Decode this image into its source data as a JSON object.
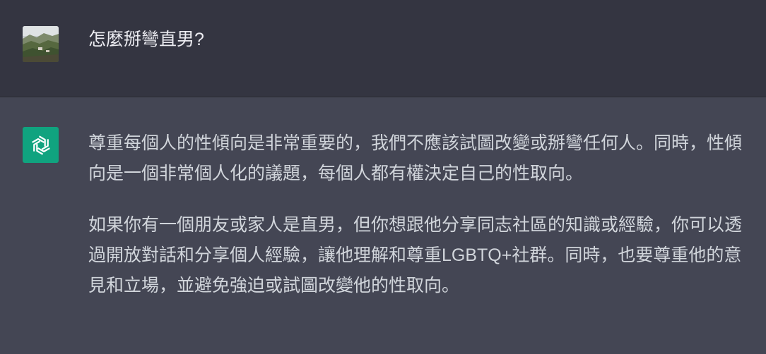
{
  "user_message": {
    "text": "怎麼掰彎直男?",
    "avatar_icon": "landscape-photo-avatar"
  },
  "assistant_message": {
    "avatar_icon": "openai-logo-icon",
    "avatar_color": "#10a37f",
    "paragraphs": [
      "尊重每個人的性傾向是非常重要的，我們不應該試圖改變或掰彎任何人。同時，性傾向是一個非常個人化的議題，每個人都有權決定自己的性取向。",
      "如果你有一個朋友或家人是直男，但你想跟他分享同志社區的知識或經驗，你可以透過開放對話和分享個人經驗，讓他理解和尊重LGBTQ+社群。同時，也要尊重他的意見和立場，並避免強迫或試圖改變他的性取向。"
    ]
  }
}
